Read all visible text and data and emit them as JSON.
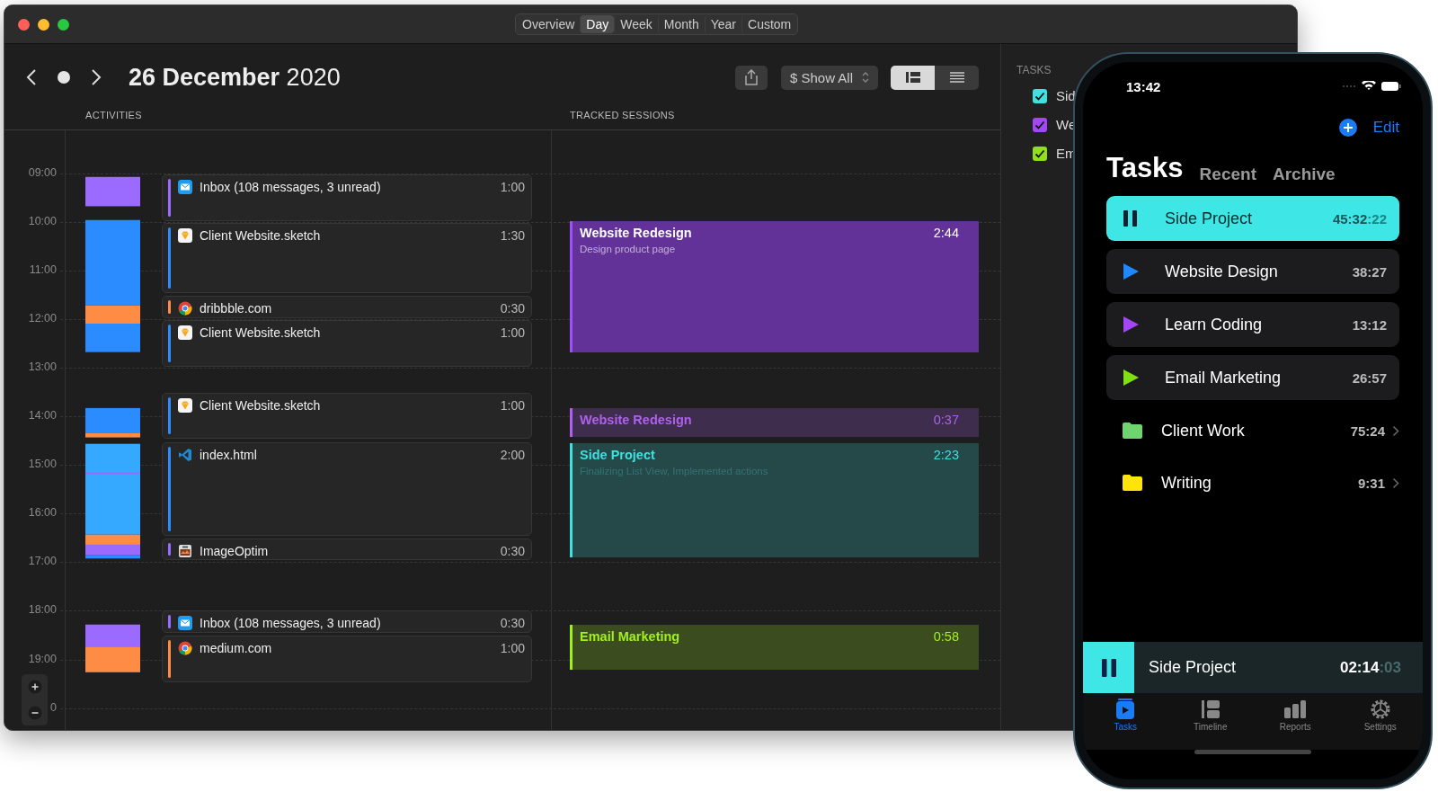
{
  "window": {
    "view_tabs": [
      {
        "label": "Overview",
        "selected": false
      },
      {
        "label": "Day",
        "selected": true
      },
      {
        "label": "Week",
        "selected": false
      },
      {
        "label": "Month",
        "selected": false
      },
      {
        "label": "Year",
        "selected": false
      },
      {
        "label": "Custom",
        "selected": false
      }
    ]
  },
  "toolbar": {
    "date": "**26 December** 2020",
    "filter": "$ Show All",
    "view_modes": [
      {
        "kind": "timeline",
        "selected": true
      },
      {
        "kind": "list",
        "selected": false
      }
    ]
  },
  "columns": [
    "ACTIVITIES",
    "TRACKED SESSIONS"
  ],
  "hours": [
    "09:00",
    "10:00",
    "11:00",
    "12:00",
    "13:00",
    "14:00",
    "15:00",
    "16:00",
    "17:00",
    "18:00",
    "19:00",
    "0"
  ],
  "activities": [
    {
      "kind": "mail",
      "color": "#9b6bff",
      "name": "Inbox (108 messages, 3 unread)",
      "duration": "1:00"
    },
    {
      "kind": "sketch",
      "color": "#2a8cff",
      "name": "Client Website.sketch",
      "duration": "1:30"
    },
    {
      "kind": "browser",
      "color": "#ff8c45",
      "name": "dribbble.com",
      "duration": "0:30"
    },
    {
      "kind": "sketch",
      "color": "#2a8cff",
      "name": "Client Website.sketch",
      "duration": "1:00"
    },
    {
      "kind": "sketch",
      "color": "#2a8cff",
      "name": "Client Website.sketch",
      "duration": "1:00"
    },
    {
      "kind": "code",
      "color": "#2a8cff",
      "name": "index.html",
      "duration": "2:00"
    },
    {
      "kind": "optimizer",
      "color": "#9b6bff",
      "name": "ImageOptim",
      "duration": "0:30"
    },
    {
      "kind": "mail",
      "color": "#9b6bff",
      "name": "Inbox (108 messages, 3 unread)",
      "duration": "0:30"
    },
    {
      "kind": "browser",
      "color": "#ff8c45",
      "name": "medium.com",
      "duration": "1:00"
    }
  ],
  "sessions": [
    {
      "kind": "solid",
      "color": "#a050f5",
      "title": "Website Redesign",
      "note": "Design product page",
      "duration": "2:44"
    },
    {
      "kind": "tinted",
      "color": "#b060f0",
      "title": "Website Redesign",
      "duration": "0:37"
    },
    {
      "kind": "tinted",
      "color": "#40e0e0",
      "title": "Side Project",
      "note": "Finalizing List View, Implemented actions",
      "duration": "2:23"
    },
    {
      "kind": "tinted",
      "color": "#a0f020",
      "title": "Email Marketing",
      "duration": "0:58"
    }
  ],
  "sidebar": {
    "title": "TASKS",
    "tasks": [
      {
        "label": "Sid",
        "checked": true,
        "color": "#3ee0e0"
      },
      {
        "label": "We",
        "checked": true,
        "color": "#a346f5"
      },
      {
        "label": "Em",
        "checked": true,
        "color": "#8fe01a"
      }
    ]
  },
  "phone": {
    "status_time": "13:42",
    "edit": "Edit",
    "tabs": [
      {
        "label": "Tasks",
        "selected": true
      },
      {
        "label": "Recent",
        "selected": false
      },
      {
        "label": "Archive",
        "selected": false
      }
    ],
    "tasks": [
      {
        "kind": "running",
        "name": "Side Project",
        "time": "45:32",
        "seconds": ":22",
        "color": "#3ee6e6"
      },
      {
        "kind": "task",
        "name": "Website Design",
        "time": "38:27",
        "color": "#1e88ff"
      },
      {
        "kind": "task",
        "name": "Learn Coding",
        "time": "13:12",
        "color": "#a346f5"
      },
      {
        "kind": "task",
        "name": "Email Marketing",
        "time": "26:57",
        "color": "#7fe014"
      },
      {
        "kind": "folder",
        "name": "Client Work",
        "time": "75:24",
        "color": "#6fd66f"
      },
      {
        "kind": "folder",
        "name": "Writing",
        "time": "9:31",
        "color": "#ffe40a"
      }
    ],
    "now_playing": {
      "name": "Side Project",
      "time": "02:14",
      "seconds": ":03",
      "color": "#3ee6e6"
    },
    "tab_bar": [
      {
        "label": "Tasks",
        "kind": "tasks",
        "selected": true
      },
      {
        "label": "Timeline",
        "kind": "timeline",
        "selected": false
      },
      {
        "label": "Reports",
        "kind": "reports",
        "selected": false
      },
      {
        "label": "Settings",
        "kind": "settings",
        "selected": false
      }
    ]
  }
}
